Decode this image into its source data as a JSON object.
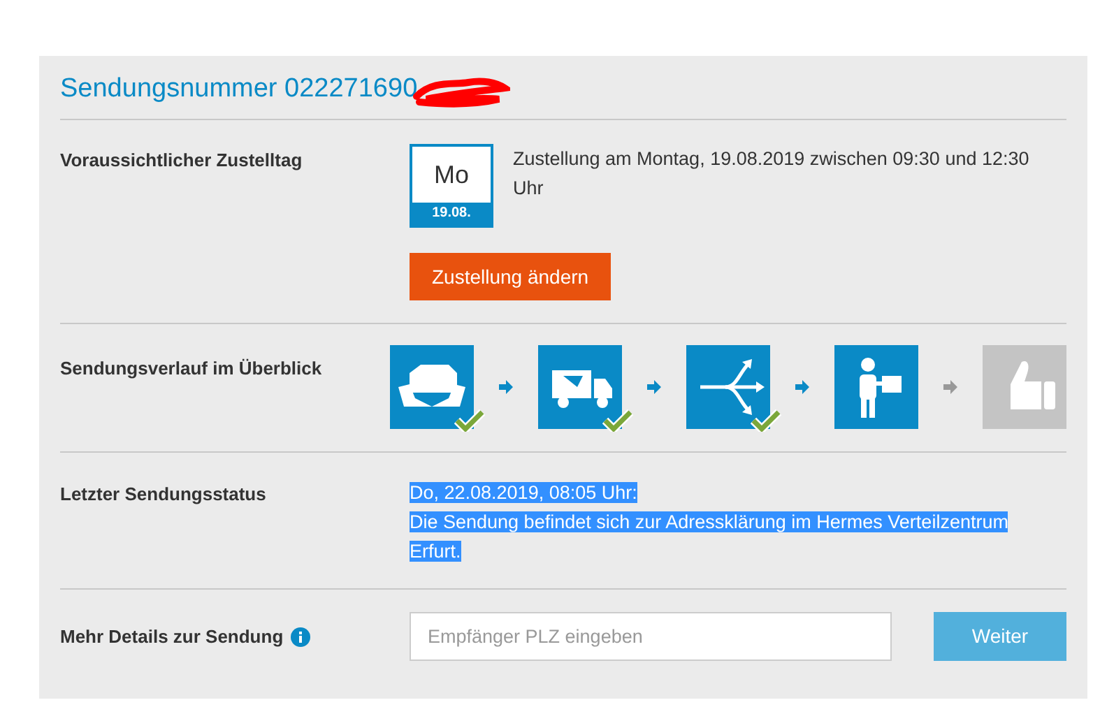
{
  "title": "Sendungsnummer 022271690",
  "title_redacted": true,
  "delivery": {
    "label": "Voraussichtlicher Zustelltag",
    "day": "Mo",
    "date": "19.08.",
    "text": "Zustellung am Montag, 19.08.2019 zwischen 09:30 und 12:30 Uhr",
    "button": "Zustellung ändern"
  },
  "progress": {
    "label": "Sendungsverlauf im Überblick",
    "steps": [
      {
        "kind": "package",
        "active": true,
        "done": true
      },
      {
        "kind": "truck",
        "active": true,
        "done": true
      },
      {
        "kind": "split",
        "active": true,
        "done": true
      },
      {
        "kind": "courier",
        "active": true,
        "done": false
      },
      {
        "kind": "thumb",
        "active": false,
        "done": false
      }
    ]
  },
  "status": {
    "label": "Letzter Sendungsstatus",
    "highlighted": true,
    "lines": [
      "Do, 22.08.2019, 08:05 Uhr:",
      "Die Sendung befindet sich zur Adressklärung im Hermes Verteilzentrum Erfurt."
    ]
  },
  "details": {
    "label": "Mehr Details zur Sendung",
    "placeholder": "Empfänger PLZ eingeben",
    "button": "Weiter"
  }
}
